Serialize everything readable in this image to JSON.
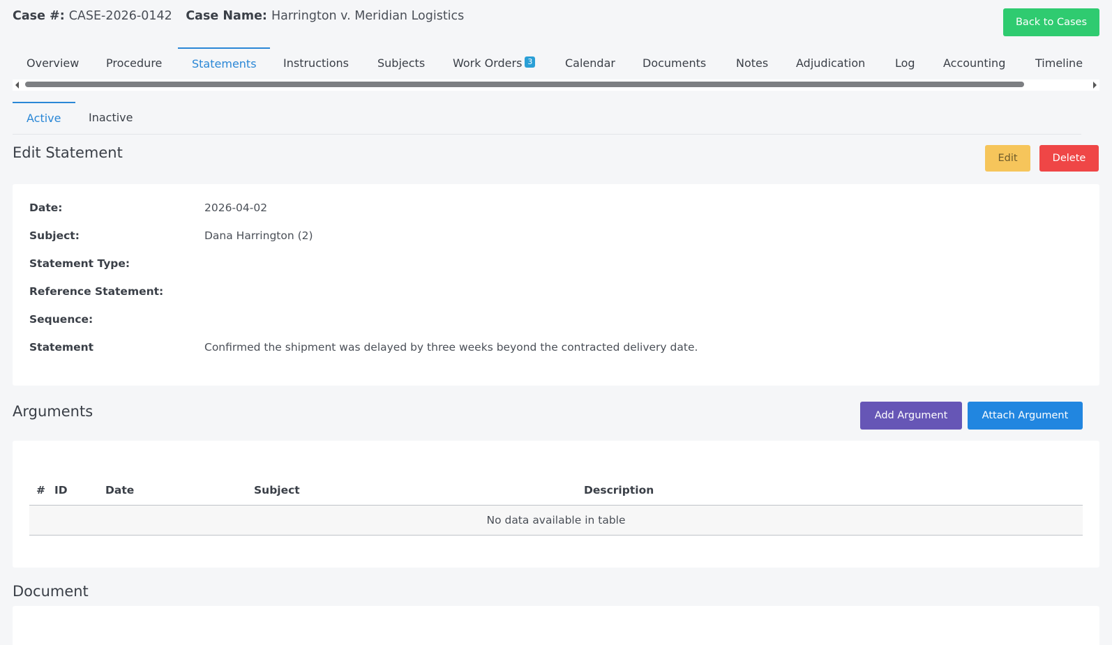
{
  "header": {
    "case_number_label": "Case #:",
    "case_number": "CASE-2026-0142",
    "case_name_label": "Case Name:",
    "case_name": "Harrington v. Meridian Logistics",
    "back_button": "Back to Cases"
  },
  "tabs": [
    {
      "label": "Overview"
    },
    {
      "label": "Procedure"
    },
    {
      "label": "Statements"
    },
    {
      "label": "Instructions"
    },
    {
      "label": "Subjects"
    },
    {
      "label": "Work Orders",
      "badge": "3"
    },
    {
      "label": "Calendar"
    },
    {
      "label": "Documents"
    },
    {
      "label": "Notes"
    },
    {
      "label": "Adjudication"
    },
    {
      "label": "Log"
    },
    {
      "label": "Accounting"
    },
    {
      "label": "Timeline"
    }
  ],
  "active_tab": "Statements",
  "subtabs": [
    {
      "label": "Active"
    },
    {
      "label": "Inactive"
    }
  ],
  "active_subtab": "Active",
  "statement": {
    "title": "Edit Statement",
    "edit_button": "Edit",
    "delete_button": "Delete",
    "fields": {
      "date_label": "Date:",
      "date": "2026-04-02",
      "subject_label": "Subject:",
      "subject": "Dana Harrington (2)",
      "type_label": "Statement Type:",
      "type": "",
      "reference_label": "Reference Statement:",
      "reference": "",
      "sequence_label": "Sequence:",
      "sequence": "",
      "statement_label": "Statement",
      "statement": "Confirmed the shipment was delayed by three weeks beyond the contracted delivery date."
    }
  },
  "arguments": {
    "title": "Arguments",
    "add_button": "Add Argument",
    "attach_button": "Attach Argument",
    "columns": [
      "#",
      "ID",
      "Date",
      "Subject",
      "Description"
    ],
    "empty_message": "No data available in table"
  },
  "document": {
    "title": "Document"
  },
  "colors": {
    "accent": "#2a87d6",
    "success": "#2fcb70",
    "warning": "#f6c55b",
    "danger": "#ef4646",
    "purple": "#6656b6",
    "primary": "#2186e0"
  }
}
